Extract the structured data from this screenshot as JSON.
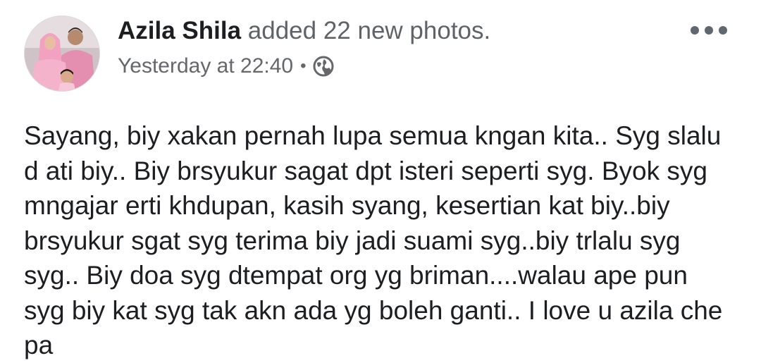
{
  "post": {
    "author_name": "Azila Shila",
    "action_text": " added 22 new photos.",
    "timestamp": "Yesterday at 22:40",
    "separator": "•",
    "privacy_icon": "globe-icon",
    "more_icon": "more-options-icon",
    "body_lines": [
      "Sayang, biy xakan pernah lupa semua kngan kita.. Syg slalu",
      "d ati biy.. Biy brsyukur sagat dpt isteri seperti syg. Byok syg",
      "mngajar erti khdupan, kasih syang, kesertian kat biy..biy",
      "brsyukur sgat syg terima biy jadi suami syg..biy trlalu syg",
      "syg.. Biy doa syg dtempat org yg briman....walau ape pun",
      "syg biy kat syg tak akn ada yg boleh ganti.. I love u azila che",
      "pa"
    ]
  },
  "colors": {
    "name": "#1c1e21",
    "secondary": "#65676b",
    "body_text": "#1c1e21",
    "background": "#ffffff"
  }
}
